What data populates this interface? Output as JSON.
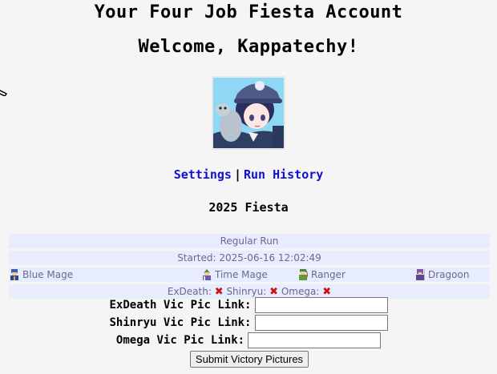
{
  "header": {
    "title": "Your Four Job Fiesta Account",
    "welcome": "Welcome, Kappatechy!"
  },
  "avatar": {
    "alt": "Kappatechy avatar"
  },
  "nav": {
    "settings": "Settings",
    "separator": "|",
    "run_history": "Run History"
  },
  "fiesta_title": "2025 Fiesta",
  "run": {
    "type": "Regular Run",
    "started": "Started: 2025-06-16 12:02:49",
    "jobs": [
      {
        "label": "Blue Mage"
      },
      {
        "label": "Time Mage"
      },
      {
        "label": "Ranger"
      },
      {
        "label": "Dragoon"
      }
    ],
    "bosses": [
      {
        "label": "ExDeath:",
        "status": "✖"
      },
      {
        "label": "Shinryu:",
        "status": "✖"
      },
      {
        "label": "Omega:",
        "status": "✖"
      }
    ]
  },
  "victory_form": {
    "exdeath_label": "ExDeath Vic Pic Link:",
    "shinryu_label": "Shinryu Vic Pic Link:",
    "omega_label": "Omega Vic Pic Link:",
    "exdeath_value": "",
    "shinryu_value": "",
    "omega_value": "",
    "submit_label": "Submit Victory Pictures"
  },
  "colors": {
    "link": "#1010d0",
    "panel_bg": "#e8ecff",
    "panel_text": "#6a6a8a",
    "fail_mark": "#d01010"
  }
}
